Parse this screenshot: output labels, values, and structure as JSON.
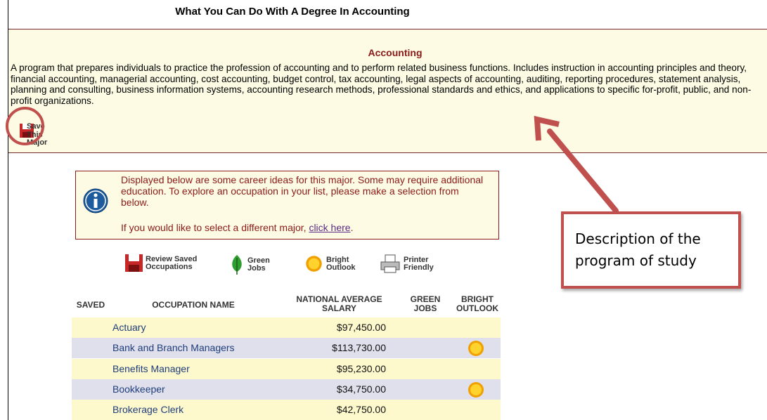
{
  "page": {
    "title": "What You Can Do With A Degree In Accounting"
  },
  "major": {
    "name": "Accounting",
    "description": "A program that prepares individuals to practice the profession of accounting and to perform related business functions. Includes instruction in accounting principles and theory, financial accounting, managerial accounting, cost accounting, budget control, tax accounting, legal aspects of accounting, auditing, reporting procedures, statement analysis, planning and consulting, business information systems, accounting research methods, professional standards and ethics, and applications to specific for-profit, public, and non-profit organizations.",
    "save_label": "Save This Major",
    "save_icon": "floppy-disk-icon"
  },
  "info": {
    "text": "Displayed below are some career ideas for this major. Some may require additional education. To explore an occupation in your list, please make a selection from below.",
    "prefix": "If you would like to select a different major, ",
    "link": "click here",
    "suffix": ".",
    "icon": "info-icon"
  },
  "toolbar": {
    "review": "Review Saved Occupations",
    "green": "Green Jobs",
    "bright": "Bright Outlook",
    "printer": "Printer Friendly"
  },
  "table": {
    "headers": {
      "saved": "SAVED",
      "name": "OCCUPATION NAME",
      "salary": "NATIONAL AVERAGE SALARY",
      "green": "GREEN JOBS",
      "bright": "BRIGHT OUTLOOK"
    },
    "rows": [
      {
        "name": "Actuary",
        "salary": "$97,450.00",
        "bright": false
      },
      {
        "name": "Bank and Branch Managers",
        "salary": "$113,730.00",
        "bright": true
      },
      {
        "name": "Benefits Manager",
        "salary": "$95,230.00",
        "bright": false
      },
      {
        "name": "Bookkeeper",
        "salary": "$34,750.00",
        "bright": true
      },
      {
        "name": "Brokerage Clerk",
        "salary": "$42,750.00",
        "bright": false
      }
    ]
  },
  "callout": {
    "text": "Description of the program of study"
  },
  "colors": {
    "annotation": "#c0504d",
    "major_title": "#8b1a1a",
    "link": "#1f3d7a",
    "row_odd": "#fdf9cc",
    "row_even": "#dfe0ec"
  }
}
